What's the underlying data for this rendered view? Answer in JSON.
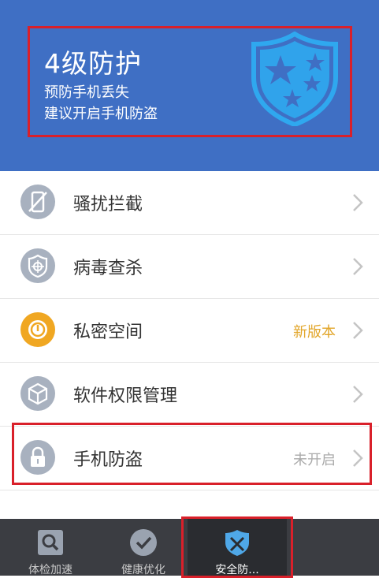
{
  "header": {
    "title": "4级防护",
    "line1": "预防手机丢失",
    "line2": "建议开启手机防盗"
  },
  "menu": [
    {
      "label": "骚扰拦截",
      "status": "",
      "icon": "phone-block-icon"
    },
    {
      "label": "病毒查杀",
      "status": "",
      "icon": "virus-scan-shield-icon"
    },
    {
      "label": "私密空间",
      "status": "新版本",
      "icon": "private-space-icon"
    },
    {
      "label": "软件权限管理",
      "status": "",
      "icon": "permission-cube-icon"
    },
    {
      "label": "手机防盗",
      "status": "未开启",
      "icon": "lock-icon"
    }
  ],
  "tabs": [
    {
      "label": "体检加速",
      "icon": "search-icon"
    },
    {
      "label": "健康优化",
      "icon": "check-icon"
    },
    {
      "label": "安全防...",
      "icon": "security-shield-icon"
    }
  ],
  "colors": {
    "header_bg": "#3f6fc4",
    "shield": "#2fa8ef",
    "highlight": "#d9202a",
    "new_version": "#e2a62a",
    "status_gray": "#aaaaaa",
    "tabbar_bg": "#3b3d42"
  }
}
